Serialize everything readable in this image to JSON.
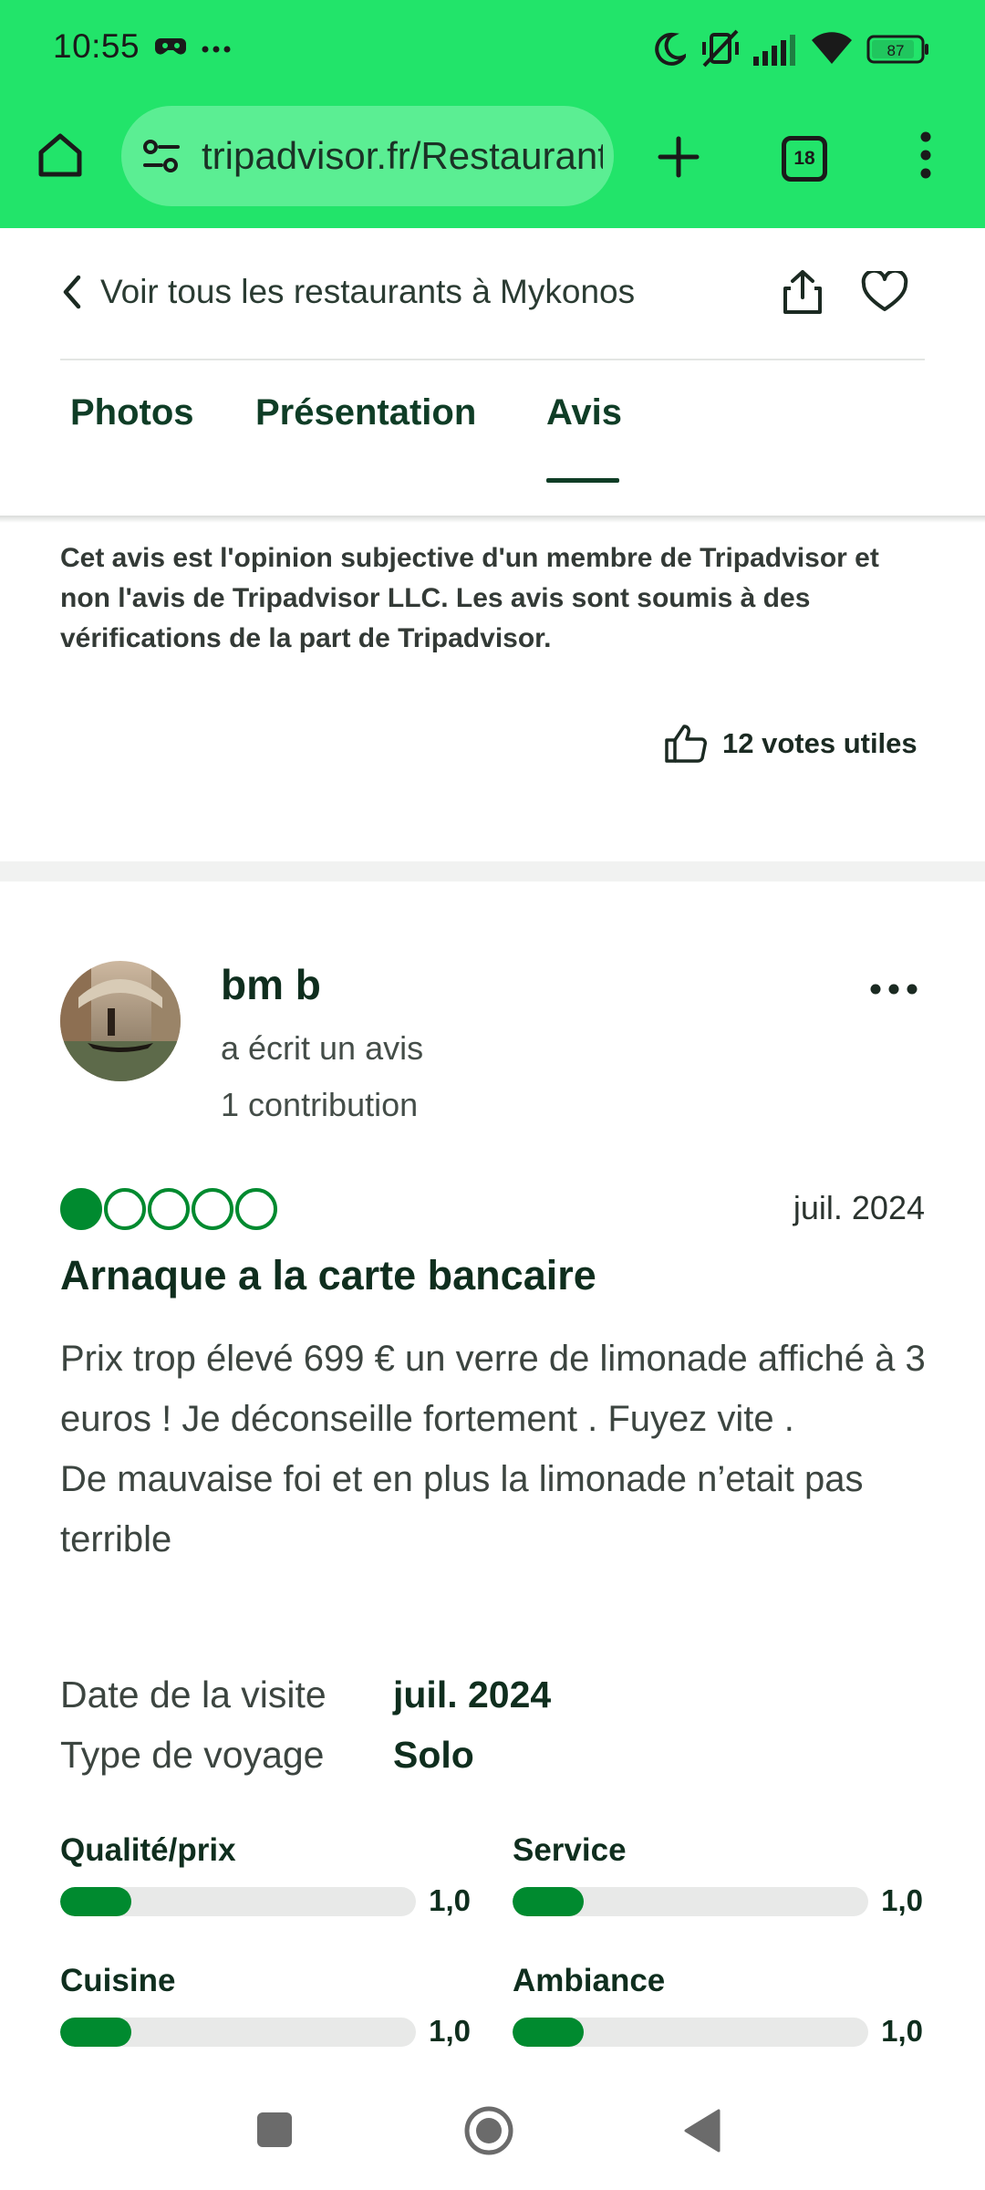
{
  "status_bar": {
    "time": "10:55",
    "battery": "87",
    "icons": [
      "game-controller-icon",
      "more-dots-icon",
      "do-not-disturb-moon-icon",
      "vibrate-muted-icon",
      "signal-icon",
      "wifi-icon",
      "battery-icon"
    ]
  },
  "browser": {
    "url": "tripadvisor.fr/Restaurant",
    "tab_count": "18",
    "accent": "#22e46a"
  },
  "header": {
    "back_label": "Voir tous les restaurants à Mykonos",
    "tabs": [
      {
        "label": "Photos",
        "active": false
      },
      {
        "label": "Présentation",
        "active": false
      },
      {
        "label": "Avis",
        "active": true
      }
    ]
  },
  "previous_review": {
    "disclaimer": "Cet avis est l'opinion subjective d'un membre de Tripadvisor et non l'avis de Tripadvisor LLC. Les avis sont soumis à des vérifications de la part de Tripadvisor.",
    "votes_label": "12 votes utiles"
  },
  "review": {
    "username": "bm b",
    "action": "a écrit un avis",
    "contributions": "1 contribution",
    "rating": 1,
    "rating_max": 5,
    "date": "juil. 2024",
    "title": "Arnaque a la carte bancaire",
    "body": "Prix trop élevé 699 € un verre de limonade affiché à 3 euros ! Je déconseille fortement . Fuyez vite .\nDe mauvaise foi et en plus la limonade n’etait pas terrible",
    "visit_date_label": "Date de la visite",
    "visit_date_value": "juil. 2024",
    "trip_type_label": "Type de voyage",
    "trip_type_value": "Solo",
    "subratings": [
      {
        "label": "Qualité/prix",
        "value": "1,0",
        "fraction": 0.2
      },
      {
        "label": "Service",
        "value": "1,0",
        "fraction": 0.2
      },
      {
        "label": "Cuisine",
        "value": "1,0",
        "fraction": 0.2
      },
      {
        "label": "Ambiance",
        "value": "1,0",
        "fraction": 0.2
      }
    ],
    "accent": "#008a2f"
  }
}
